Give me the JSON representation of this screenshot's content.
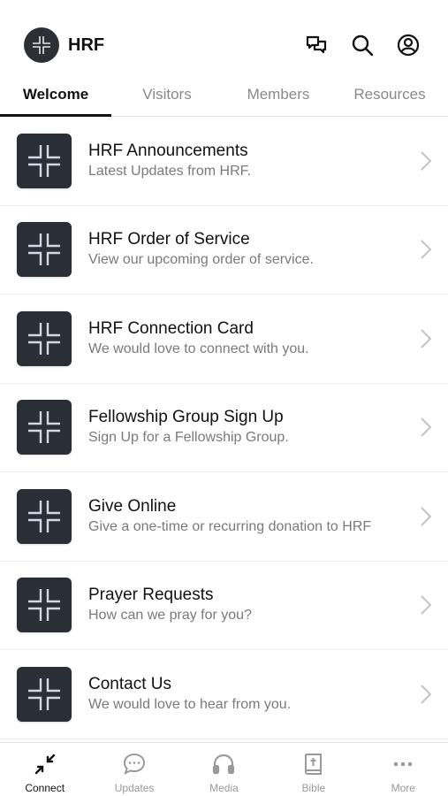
{
  "header": {
    "title": "HRF",
    "icons": [
      "chat-icon",
      "search-icon",
      "account-icon"
    ]
  },
  "tabs": [
    {
      "label": "Welcome",
      "active": true
    },
    {
      "label": "Visitors",
      "active": false
    },
    {
      "label": "Members",
      "active": false
    },
    {
      "label": "Resources",
      "active": false
    }
  ],
  "list": [
    {
      "title": "HRF Announcements",
      "subtitle": "Latest Updates from HRF."
    },
    {
      "title": "HRF Order of Service",
      "subtitle": "View our upcoming order of service."
    },
    {
      "title": "HRF Connection Card",
      "subtitle": "We would love to connect with you."
    },
    {
      "title": "Fellowship Group Sign Up",
      "subtitle": "Sign Up for a Fellowship Group."
    },
    {
      "title": "Give Online",
      "subtitle": "Give a one-time or recurring donation to HRF"
    },
    {
      "title": "Prayer Requests",
      "subtitle": "How can we pray for you?"
    },
    {
      "title": "Contact Us",
      "subtitle": "We would love to hear from you."
    }
  ],
  "bottom_nav": [
    {
      "label": "Connect",
      "icon": "connect-arrows-icon",
      "active": true
    },
    {
      "label": "Updates",
      "icon": "chat-bubble-icon",
      "active": false
    },
    {
      "label": "Media",
      "icon": "headphones-icon",
      "active": false
    },
    {
      "label": "Bible",
      "icon": "bible-icon",
      "active": false
    },
    {
      "label": "More",
      "icon": "more-dots-icon",
      "active": false
    }
  ],
  "colors": {
    "accent": "#111111",
    "tile_background": "#2a2e35",
    "muted_text": "#7a7a7a"
  }
}
